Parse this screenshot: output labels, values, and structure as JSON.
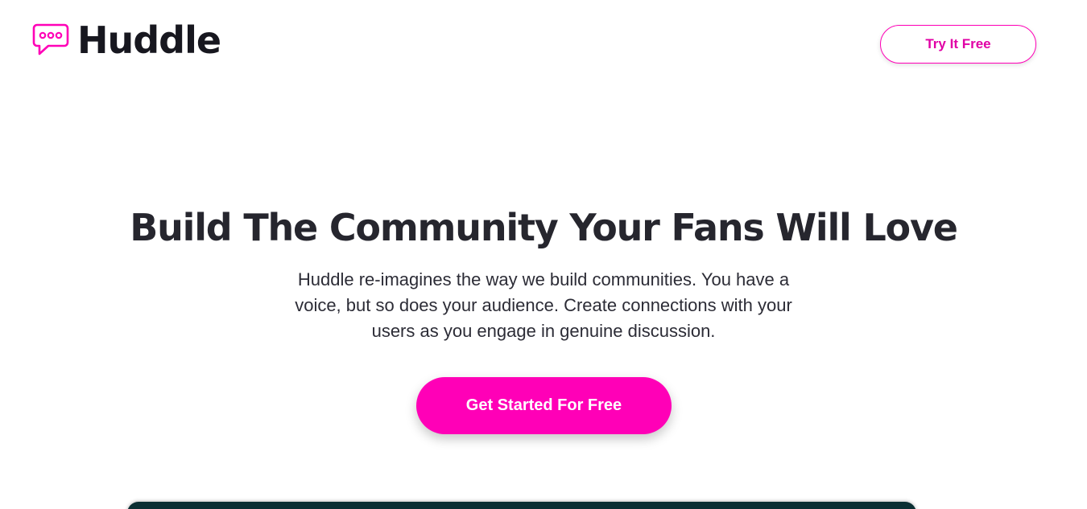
{
  "header": {
    "logo_text": "Huddle",
    "logo_icon": "chat-bubble-icon",
    "try_label": "Try It Free"
  },
  "hero": {
    "title": "Build The Community Your Fans Will Love",
    "description": "Huddle re-imagines the way we build communities. You have a voice, but so does your audience. Create connections with your users as you engage in genuine discussion.",
    "cta_label": "Get Started For Free"
  },
  "colors": {
    "accent": "#ff00b7",
    "heading": "#26262e",
    "mockup_frame": "#0b2f33"
  }
}
